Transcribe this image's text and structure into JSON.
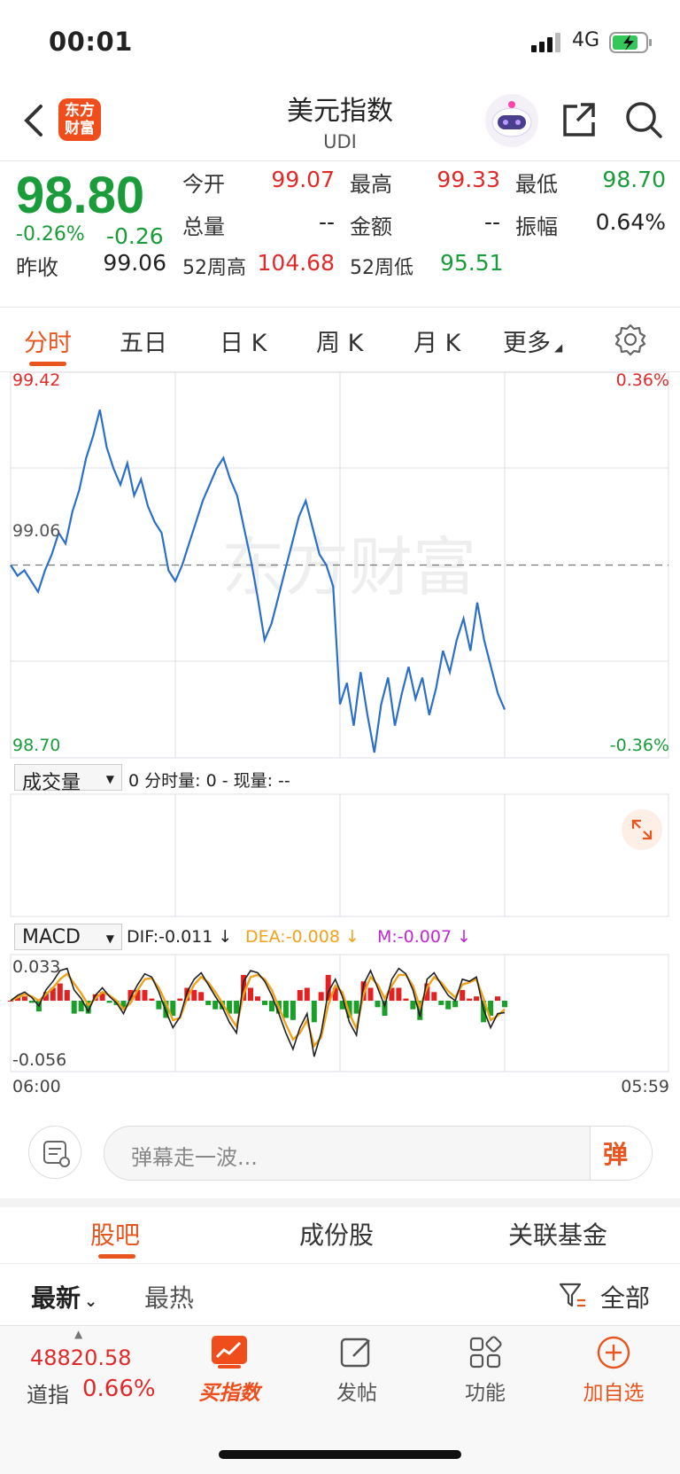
{
  "status": {
    "time": "00:01",
    "network": "4G"
  },
  "header": {
    "title": "美元指数",
    "code": "UDI",
    "logo_text_1": "东方",
    "logo_text_2": "财富"
  },
  "quote": {
    "price": "98.80",
    "change_pct": "-0.26%",
    "change": "-0.26",
    "fields": [
      {
        "label": "今开",
        "value": "99.07",
        "color": "red"
      },
      {
        "label": "最高",
        "value": "99.33",
        "color": "red"
      },
      {
        "label": "最低",
        "value": "98.70",
        "color": "green"
      },
      {
        "label": "总量",
        "value": "--",
        "color": "blk"
      },
      {
        "label": "金额",
        "value": "--",
        "color": "blk"
      },
      {
        "label": "振幅",
        "value": "0.64%",
        "color": "blk"
      },
      {
        "label": "昨收",
        "value": "99.06",
        "color": "blk"
      },
      {
        "label": "52周高",
        "value": "104.68",
        "color": "red"
      },
      {
        "label": "52周低",
        "value": "95.51",
        "color": "green"
      }
    ]
  },
  "tabs": [
    "分时",
    "五日",
    "日 K",
    "周 K",
    "月 K",
    "更多"
  ],
  "chart_data": {
    "type": "line",
    "title": "",
    "y_left_ticks": [
      "99.42",
      "99.06",
      "98.70"
    ],
    "y_right_ticks": [
      "0.36%",
      "-0.36%"
    ],
    "ylim": [
      98.7,
      99.42
    ],
    "prev_close": 99.06,
    "x_ticks": [
      "06:00",
      "05:59"
    ],
    "watermark": "东方财富",
    "price_series": [
      99.06,
      99.04,
      99.05,
      99.03,
      99.01,
      99.05,
      99.08,
      99.12,
      99.1,
      99.16,
      99.2,
      99.26,
      99.3,
      99.35,
      99.28,
      99.24,
      99.21,
      99.25,
      99.19,
      99.22,
      99.17,
      99.14,
      99.12,
      99.05,
      99.03,
      99.06,
      99.1,
      99.14,
      99.18,
      99.21,
      99.24,
      99.26,
      99.22,
      99.19,
      99.13,
      99.07,
      99.0,
      98.92,
      98.95,
      99.0,
      99.05,
      99.1,
      99.15,
      99.18,
      99.13,
      99.08,
      99.06,
      99.02,
      98.8,
      98.84,
      98.76,
      98.86,
      98.78,
      98.71,
      98.8,
      98.85,
      98.76,
      98.82,
      98.87,
      98.81,
      98.85,
      98.78,
      98.83,
      98.9,
      98.86,
      98.92,
      98.96,
      98.9,
      98.99,
      98.92,
      98.87,
      98.82,
      98.79
    ],
    "volume": {
      "label": "成交量",
      "info": "0 分时量: 0 - 现量: --"
    },
    "macd": {
      "label": "MACD",
      "dif": "DIF:-0.011 ↓",
      "dea": "DEA:-0.008 ↓",
      "m": "M:-0.007 ↓",
      "top": "0.033",
      "bottom": "-0.056",
      "dif_series": [
        0,
        0.005,
        0.008,
        0.003,
        -0.005,
        0.01,
        0.018,
        0.028,
        0.03,
        0.01,
        0.002,
        -0.01,
        0.005,
        0.012,
        0.004,
        -0.002,
        -0.012,
        0.003,
        0.015,
        0.025,
        0.022,
        0.008,
        -0.01,
        -0.025,
        -0.015,
        0.008,
        0.02,
        0.026,
        0.015,
        0.004,
        -0.006,
        -0.02,
        -0.03,
        0.018,
        0.028,
        0.026,
        0.018,
        0.005,
        -0.012,
        -0.03,
        -0.045,
        -0.025,
        -0.012,
        -0.052,
        -0.03,
        0.008,
        0.02,
        0.004,
        -0.02,
        -0.032,
        0.015,
        0.028,
        0.012,
        -0.005,
        0.02,
        0.03,
        0.025,
        0.01,
        -0.015,
        0.02,
        0.026,
        0.015,
        0.005,
        0.0,
        0.02,
        0.018,
        0.022,
        -0.008,
        -0.025,
        -0.012,
        -0.011
      ],
      "dea_series": [
        0,
        0.003,
        0.006,
        0.004,
        0.0,
        0.006,
        0.012,
        0.02,
        0.025,
        0.016,
        0.007,
        -0.004,
        0.002,
        0.008,
        0.005,
        0.0,
        -0.008,
        -0.002,
        0.01,
        0.02,
        0.021,
        0.012,
        -0.002,
        -0.018,
        -0.016,
        0.002,
        0.015,
        0.022,
        0.017,
        0.008,
        -0.002,
        -0.014,
        -0.024,
        0.006,
        0.022,
        0.024,
        0.02,
        0.01,
        -0.006,
        -0.022,
        -0.036,
        -0.03,
        -0.018,
        -0.042,
        -0.034,
        -0.004,
        0.014,
        0.008,
        -0.012,
        -0.026,
        0.006,
        0.022,
        0.015,
        0.002,
        0.014,
        0.024,
        0.024,
        0.014,
        -0.006,
        0.012,
        0.022,
        0.017,
        0.009,
        0.003,
        0.015,
        0.017,
        0.02,
        0.002,
        -0.018,
        -0.014,
        -0.008
      ]
    }
  },
  "comment_input": {
    "placeholder": "弹幕走一波...",
    "dan_label": "弹"
  },
  "bottom_tabs": [
    "股吧",
    "成份股",
    "关联基金"
  ],
  "filters": {
    "latest": "最新",
    "hot": "最热",
    "all": "全部"
  },
  "navbar": {
    "dow_value": "48820.58",
    "dow_name": "道指",
    "dow_pct": "0.66%",
    "items": [
      "买指数",
      "发帖",
      "功能",
      "加自选"
    ]
  }
}
